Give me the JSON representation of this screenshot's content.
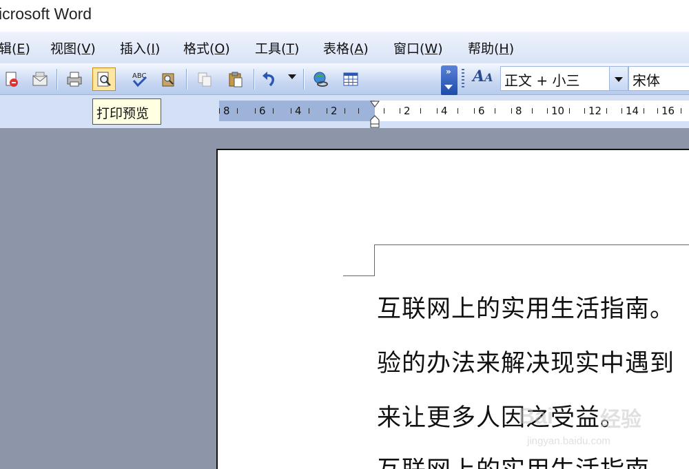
{
  "window": {
    "title": "icrosoft Word"
  },
  "menubar": {
    "items": [
      {
        "label": "辑(",
        "key": "E",
        "tail": ")"
      },
      {
        "label": "视图(",
        "key": "V",
        "tail": ")"
      },
      {
        "label": "插入(",
        "key": "I",
        "tail": ")"
      },
      {
        "label": "格式(",
        "key": "O",
        "tail": ")"
      },
      {
        "label": "工具(",
        "key": "T",
        "tail": ")"
      },
      {
        "label": "表格(",
        "key": "A",
        "tail": ")"
      },
      {
        "label": "窗口(",
        "key": "W",
        "tail": ")"
      },
      {
        "label": "帮助(",
        "key": "H",
        "tail": ")"
      }
    ]
  },
  "toolbar": {
    "icons": [
      "permission-icon",
      "email-icon",
      "print-icon",
      "print-preview-icon",
      "spelling-icon",
      "research-icon",
      "copy-icon",
      "paste-icon",
      "undo-icon",
      "hyperlink-icon",
      "table-icon",
      "styles-icon"
    ],
    "style_value": "正文 + 小三",
    "font_value": "宋体",
    "tooltip": "打印预览"
  },
  "ruler": {
    "left_numbers": [
      "8",
      "6",
      "4",
      "2"
    ],
    "right_numbers": [
      "2",
      "4",
      "6",
      "8",
      "10",
      "12",
      "14",
      "16"
    ]
  },
  "document": {
    "lines": [
      "互联网上的实用生活指南。",
      "验的办法来解决现实中遇到",
      "来让更多人因之受益。",
      "互联网上的实用生活指南"
    ]
  },
  "watermark": {
    "brand": "Bai",
    "brand_cn": "经验",
    "url": "jingyan.baidu.com"
  },
  "colors": {
    "menubar_bg": "#dbe6f7",
    "toolbar_bg": "#c9d8f2",
    "workspace_bg": "#8d95a8",
    "active_button": "#ffe7a2"
  }
}
